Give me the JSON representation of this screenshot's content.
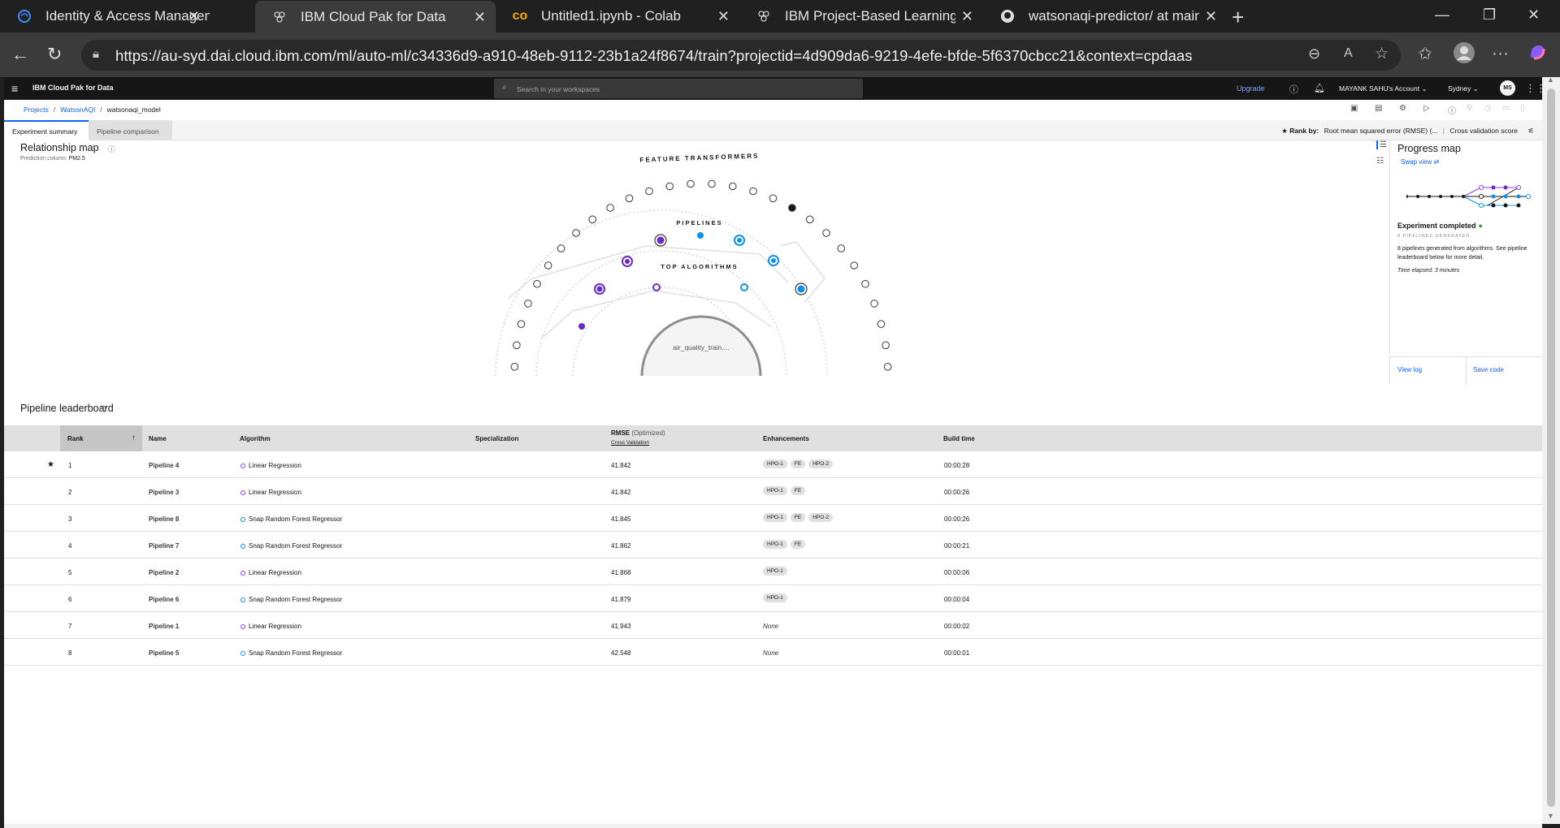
{
  "browser": {
    "tabs": [
      {
        "title": "Identity & Access Management -",
        "icon": "ibm-cloud-icon"
      },
      {
        "title": "IBM Cloud Pak for Data",
        "icon": "cloud-pak-icon"
      },
      {
        "title": "Untitled1.ipynb - Colab",
        "icon": "colab-icon"
      },
      {
        "title": "IBM Project-Based Learning Progr",
        "icon": "cloud-pak-icon"
      },
      {
        "title": "watsonaqi-predictor/ at main · ma",
        "icon": "github-icon"
      }
    ],
    "url": "https://au-syd.dai.cloud.ibm.com/ml/auto-ml/c34336d9-a910-48eb-9112-23b1a24f8674/train?projectid=4d909da6-9219-4efe-bfde-5f6370cbcc21&context=cpdaas"
  },
  "masthead": {
    "brand": "IBM Cloud Pak for Data",
    "search_placeholder": "Search in your workspaces",
    "upgrade": "Upgrade",
    "account": "MAYANK SAHU's Account",
    "region": "Sydney",
    "avatar": "MS"
  },
  "breadcrumb": {
    "projects": "Projects",
    "project": "WatsonAQI",
    "current": "watsonaqi_model"
  },
  "content_tabs": {
    "summary": "Experiment summary",
    "comparison": "Pipeline comparison"
  },
  "rank_by": {
    "label": "Rank by:",
    "metric": "Root mean squared error (RMSE) (...",
    "score": "Cross validation score"
  },
  "relationship_map": {
    "title": "Relationship map",
    "prediction_label": "Prediction column:",
    "prediction_value": "PM2.5",
    "ring_labels": {
      "outer": "FEATURE TRANSFORMERS",
      "middle": "PIPELINES",
      "inner": "TOP ALGORITHMS"
    },
    "center_label": "air_quality_train...."
  },
  "progress_map": {
    "title": "Progress map",
    "swap_view": "Swap view",
    "status": "Experiment completed",
    "pipelines_generated": "8 PIPELINES GENERATED",
    "description": "8 pipelines generated from algorithms. See pipeline leaderboard below for more detail.",
    "elapsed": "Time elapsed: 3 minutes",
    "view_log": "View log",
    "save_code": "Save code"
  },
  "leaderboard": {
    "title": "Pipeline leaderboard",
    "headers": {
      "rank": "Rank",
      "name": "Name",
      "algorithm": "Algorithm",
      "specialization": "Specialization",
      "rmse": "RMSE",
      "rmse_sub": "(Optimized)",
      "cv": "Cross Validation",
      "enhancements": "Enhancements",
      "build_time": "Build time"
    },
    "rows": [
      {
        "rank": "1",
        "name": "Pipeline 4",
        "algorithm": "Linear Regression",
        "algo_type": "lr",
        "rmse": "41.842",
        "enhancements": [
          "HPO-1",
          "FE",
          "HPO-2"
        ],
        "build_time": "00:00:28",
        "starred": true
      },
      {
        "rank": "2",
        "name": "Pipeline 3",
        "algorithm": "Linear Regression",
        "algo_type": "lr",
        "rmse": "41.842",
        "enhancements": [
          "HPO-1",
          "FE"
        ],
        "build_time": "00:00:26",
        "starred": false
      },
      {
        "rank": "3",
        "name": "Pipeline 8",
        "algorithm": "Snap Random Forest Regressor",
        "algo_type": "snap",
        "rmse": "41.845",
        "enhancements": [
          "HPO-1",
          "FE",
          "HPO-2"
        ],
        "build_time": "00:00:26",
        "starred": false
      },
      {
        "rank": "4",
        "name": "Pipeline 7",
        "algorithm": "Snap Random Forest Regressor",
        "algo_type": "snap",
        "rmse": "41.862",
        "enhancements": [
          "HPO-1",
          "FE"
        ],
        "build_time": "00:00:21",
        "starred": false
      },
      {
        "rank": "5",
        "name": "Pipeline 2",
        "algorithm": "Linear Regression",
        "algo_type": "lr",
        "rmse": "41.868",
        "enhancements": [
          "HPO-1"
        ],
        "build_time": "00:00:06",
        "starred": false
      },
      {
        "rank": "6",
        "name": "Pipeline 6",
        "algorithm": "Snap Random Forest Regressor",
        "algo_type": "snap",
        "rmse": "41.879",
        "enhancements": [
          "HPO-1"
        ],
        "build_time": "00:00:04",
        "starred": false
      },
      {
        "rank": "7",
        "name": "Pipeline 1",
        "algorithm": "Linear Regression",
        "algo_type": "lr",
        "rmse": "41.943",
        "enhancements": [],
        "build_time": "00:00:02",
        "starred": false
      },
      {
        "rank": "8",
        "name": "Pipeline 5",
        "algorithm": "Snap Random Forest Regressor",
        "algo_type": "snap",
        "rmse": "42.548",
        "enhancements": [],
        "build_time": "00:00:01",
        "starred": false
      }
    ],
    "none_label": "None"
  },
  "colors": {
    "purple": "#6929c4",
    "blue": "#1192e8",
    "ibm_blue": "#0f62fe"
  }
}
